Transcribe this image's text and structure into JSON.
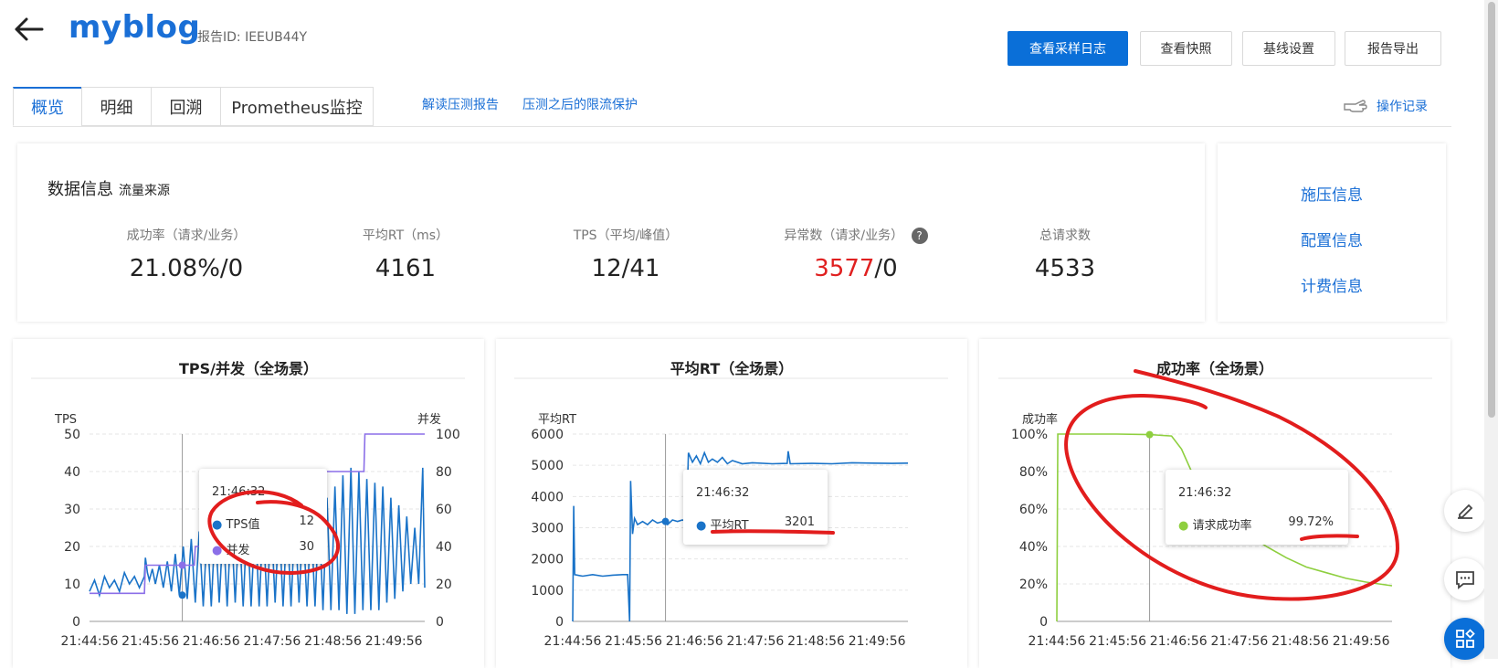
{
  "header": {
    "title": "myblog",
    "report_id": "报告ID:  IEEUB44Y",
    "buttons": [
      "查看采样日志",
      "查看快照",
      "基线设置",
      "报告导出"
    ]
  },
  "tabs": [
    "概览",
    "明细",
    "回溯",
    "Prometheus监控"
  ],
  "links": [
    "解读压测报告",
    "压测之后的限流保护"
  ],
  "operation_log": "操作记录",
  "data_info": {
    "title": "数据信息",
    "subtitle": "流量来源",
    "metrics": [
      {
        "label": "成功率（请求/业务）",
        "value": "21.08%/0"
      },
      {
        "label": "平均RT（ms）",
        "value": "4161"
      },
      {
        "label": "TPS（平均/峰值）",
        "value": "12/41"
      },
      {
        "label": "异常数（请求/业务）",
        "value_red": "3577",
        "value_rest": "/0"
      },
      {
        "label": "总请求数",
        "value": "4533"
      }
    ]
  },
  "side_links": [
    "施压信息",
    "配置信息",
    "计费信息"
  ],
  "colors": {
    "primary": "#0a6fd8",
    "tps": "#1a73c8",
    "concurrency": "#8b6fe8",
    "rt": "#1a73c8",
    "success": "#8ecf3f",
    "error": "#e02020",
    "annotation": "#e21d1d"
  },
  "tooltips": {
    "tps": {
      "time": "21:46:32",
      "rows": [
        {
          "name": "TPS值",
          "value": "12"
        },
        {
          "name": "并发",
          "value": "30"
        }
      ]
    },
    "rt": {
      "time": "21:46:32",
      "rows": [
        {
          "name": "平均RT",
          "value": "3201"
        }
      ]
    },
    "success": {
      "time": "21:46:32",
      "rows": [
        {
          "name": "请求成功率",
          "value": "99.72%"
        }
      ]
    }
  },
  "chart_data": [
    {
      "type": "line",
      "title": "TPS/并发（全场景）",
      "ylabel": "TPS",
      "y2label": "并发",
      "x": [
        "21:44:56",
        "21:45:56",
        "21:46:56",
        "21:47:56",
        "21:48:56",
        "21:49:56"
      ],
      "ylim": [
        0,
        50
      ],
      "y2lim": [
        0,
        100
      ],
      "yticks": [
        "0",
        "10",
        "20",
        "30",
        "40",
        "50"
      ],
      "y2ticks": [
        "0",
        "20",
        "40",
        "60",
        "80",
        "100"
      ],
      "series": [
        {
          "name": "TPS值",
          "axis": "left",
          "points": [
            [
              0,
              8
            ],
            [
              5,
              11
            ],
            [
              10,
              7
            ],
            [
              15,
              12
            ],
            [
              20,
              9
            ],
            [
              25,
              11
            ],
            [
              30,
              8
            ],
            [
              35,
              13
            ],
            [
              40,
              10
            ],
            [
              45,
              12
            ],
            [
              50,
              9
            ],
            [
              55,
              12
            ],
            [
              56,
              17
            ],
            [
              58,
              13
            ],
            [
              60,
              11
            ],
            [
              63,
              14
            ],
            [
              66,
              10
            ],
            [
              70,
              15
            ],
            [
              74,
              9
            ],
            [
              78,
              16
            ],
            [
              82,
              8
            ],
            [
              86,
              18
            ],
            [
              90,
              7
            ],
            [
              94,
              20
            ],
            [
              98,
              6
            ],
            [
              102,
              22
            ],
            [
              106,
              5
            ],
            [
              110,
              24
            ],
            [
              114,
              4
            ],
            [
              118,
              25
            ],
            [
              122,
              4
            ],
            [
              126,
              26
            ],
            [
              130,
              5
            ],
            [
              134,
              26
            ],
            [
              138,
              4
            ],
            [
              142,
              27
            ],
            [
              146,
              5
            ],
            [
              150,
              27
            ],
            [
              154,
              4
            ],
            [
              158,
              28
            ],
            [
              162,
              4
            ],
            [
              166,
              28
            ],
            [
              170,
              4
            ],
            [
              174,
              27
            ],
            [
              178,
              4
            ],
            [
              182,
              28
            ],
            [
              186,
              5
            ],
            [
              190,
              28
            ],
            [
              194,
              4
            ],
            [
              198,
              28
            ],
            [
              202,
              4
            ],
            [
              206,
              28
            ],
            [
              210,
              5
            ],
            [
              214,
              28
            ],
            [
              218,
              4
            ],
            [
              222,
              28
            ],
            [
              226,
              4
            ],
            [
              230,
              30
            ],
            [
              234,
              3
            ],
            [
              238,
              33
            ],
            [
              242,
              3
            ],
            [
              246,
              36
            ],
            [
              250,
              3
            ],
            [
              254,
              39
            ],
            [
              258,
              2
            ],
            [
              262,
              41
            ],
            [
              266,
              2
            ],
            [
              270,
              40
            ],
            [
              274,
              3
            ],
            [
              278,
              38
            ],
            [
              282,
              3
            ],
            [
              286,
              37
            ],
            [
              290,
              3
            ],
            [
              294,
              36
            ],
            [
              298,
              5
            ],
            [
              302,
              33
            ],
            [
              306,
              6
            ],
            [
              310,
              31
            ],
            [
              314,
              8
            ],
            [
              318,
              28
            ],
            [
              322,
              10
            ],
            [
              326,
              25
            ],
            [
              330,
              10
            ],
            [
              334,
              41
            ],
            [
              336,
              9
            ]
          ]
        },
        {
          "name": "并发",
          "axis": "right",
          "points": [
            [
              0,
              15
            ],
            [
              55,
              15
            ],
            [
              56,
              30
            ],
            [
              70,
              30
            ],
            [
              105,
              30
            ],
            [
              106,
              40
            ],
            [
              130,
              40
            ],
            [
              180,
              40
            ],
            [
              181,
              60
            ],
            [
              225,
              60
            ],
            [
              226,
              80
            ],
            [
              275,
              80
            ],
            [
              276,
              100
            ],
            [
              336,
              100
            ]
          ]
        }
      ]
    },
    {
      "type": "line",
      "title": "平均RT（全场景）",
      "ylabel": "平均RT",
      "x": [
        "21:44:56",
        "21:45:56",
        "21:46:56",
        "21:47:56",
        "21:48:56",
        "21:49:56"
      ],
      "ylim": [
        0,
        6000
      ],
      "yticks": [
        "0",
        "1000",
        "2000",
        "3000",
        "4000",
        "5000",
        "6000"
      ],
      "series": [
        {
          "name": "平均RT",
          "points": [
            [
              0,
              0
            ],
            [
              1,
              3700
            ],
            [
              2,
              1500
            ],
            [
              10,
              1450
            ],
            [
              20,
              1500
            ],
            [
              30,
              1450
            ],
            [
              40,
              1480
            ],
            [
              50,
              1500
            ],
            [
              55,
              1500
            ],
            [
              57,
              0
            ],
            [
              58,
              4500
            ],
            [
              60,
              2800
            ],
            [
              62,
              3300
            ],
            [
              65,
              3100
            ],
            [
              70,
              3200
            ],
            [
              75,
              3100
            ],
            [
              80,
              3250
            ],
            [
              85,
              3150
            ],
            [
              90,
              3200
            ],
            [
              95,
              3100
            ],
            [
              100,
              3250
            ],
            [
              105,
              3200
            ],
            [
              110,
              3250
            ],
            [
              114,
              3200
            ],
            [
              116,
              5400
            ],
            [
              120,
              5100
            ],
            [
              124,
              5300
            ],
            [
              128,
              5050
            ],
            [
              132,
              5400
            ],
            [
              136,
              5100
            ],
            [
              140,
              5200
            ],
            [
              145,
              5100
            ],
            [
              150,
              5250
            ],
            [
              155,
              5050
            ],
            [
              160,
              5150
            ],
            [
              170,
              5050
            ],
            [
              180,
              5080
            ],
            [
              200,
              5050
            ],
            [
              215,
              5060
            ],
            [
              216,
              5450
            ],
            [
              218,
              5050
            ],
            [
              240,
              5060
            ],
            [
              260,
              5050
            ],
            [
              280,
              5080
            ],
            [
              300,
              5070
            ],
            [
              320,
              5060
            ],
            [
              336,
              5070
            ]
          ]
        }
      ]
    },
    {
      "type": "line",
      "title": "成功率（全场景）",
      "ylabel": "成功率",
      "x": [
        "21:44:56",
        "21:45:56",
        "21:46:56",
        "21:47:56",
        "21:48:56",
        "21:49:56"
      ],
      "ylim": [
        0,
        100
      ],
      "yticks": [
        "0",
        "20%",
        "40%",
        "60%",
        "80%",
        "100%"
      ],
      "series": [
        {
          "name": "请求成功率",
          "points": [
            [
              0,
              0
            ],
            [
              1,
              100
            ],
            [
              60,
              100
            ],
            [
              93,
              99.7
            ],
            [
              115,
              99
            ],
            [
              125,
              92
            ],
            [
              135,
              80
            ],
            [
              150,
              68
            ],
            [
              170,
              56
            ],
            [
              190,
              47
            ],
            [
              210,
              40
            ],
            [
              230,
              34
            ],
            [
              250,
              29
            ],
            [
              270,
              26
            ],
            [
              290,
              23
            ],
            [
              310,
              21
            ],
            [
              336,
              19
            ]
          ]
        }
      ]
    }
  ]
}
